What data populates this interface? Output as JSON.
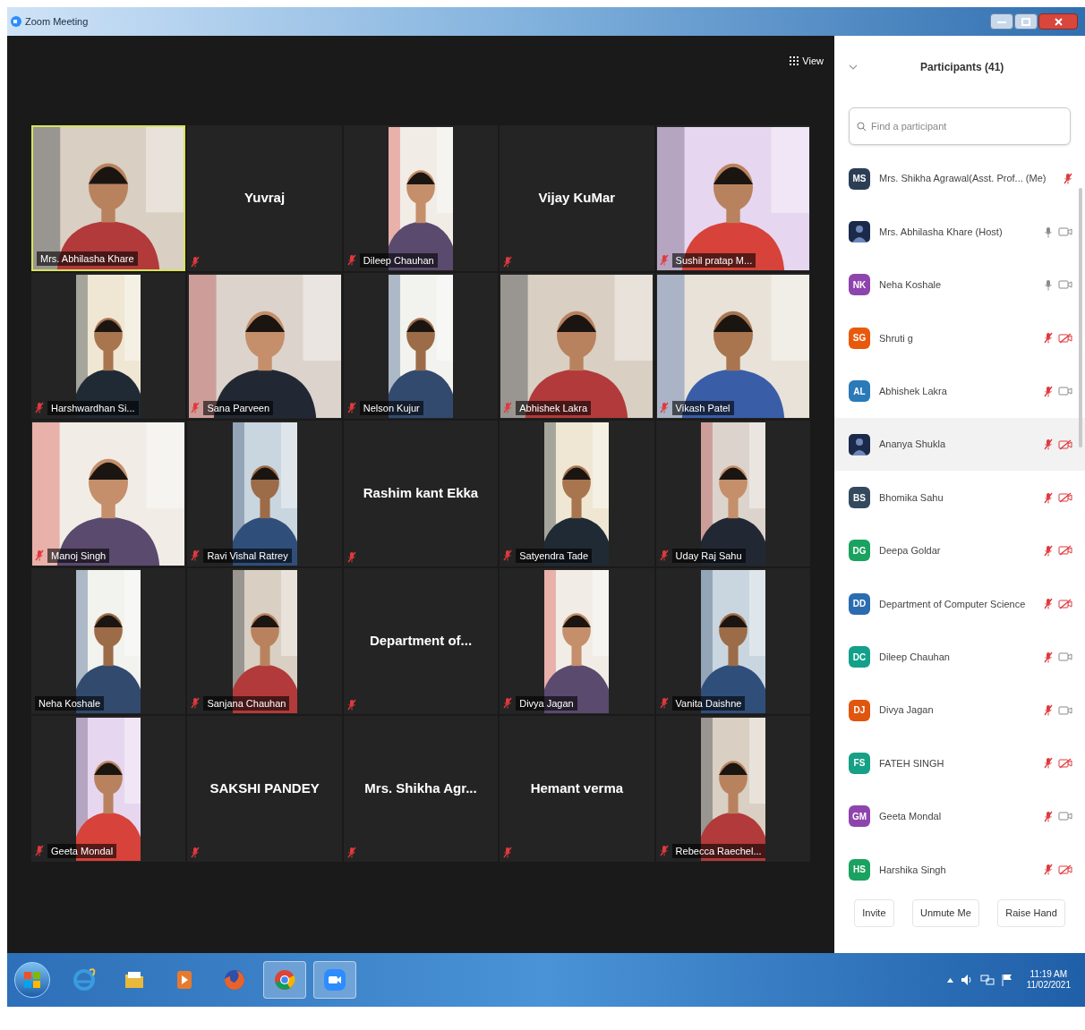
{
  "window": {
    "title": "Zoom Meeting"
  },
  "view_button": {
    "label": "View"
  },
  "tiles": [
    {
      "name": "Mrs. Abhilasha Khare",
      "kind": "video_wide",
      "muted": false,
      "active": true
    },
    {
      "name": "Yuvraj",
      "kind": "no_video",
      "muted": true,
      "active": false
    },
    {
      "name": "Dileep Chauhan",
      "kind": "video_portrait",
      "muted": true,
      "active": false
    },
    {
      "name": "Vijay KuMar",
      "kind": "no_video",
      "muted": true,
      "active": false
    },
    {
      "name": "Sushil pratap M...",
      "kind": "video_wide",
      "muted": true,
      "active": false
    },
    {
      "name": "Harshwardhan Si...",
      "kind": "video_portrait",
      "muted": true,
      "active": false
    },
    {
      "name": "Sana Parveen",
      "kind": "video_wide",
      "muted": true,
      "active": false
    },
    {
      "name": "Nelson Kujur",
      "kind": "video_portrait",
      "muted": true,
      "active": false
    },
    {
      "name": "Abhishek Lakra",
      "kind": "video_wide",
      "muted": true,
      "active": false
    },
    {
      "name": "Vikash Patel",
      "kind": "video_wide",
      "muted": true,
      "active": false
    },
    {
      "name": "Manoj Singh",
      "kind": "video_wide",
      "muted": true,
      "active": false
    },
    {
      "name": "Ravi Vishal Ratrey",
      "kind": "video_portrait",
      "muted": true,
      "active": false
    },
    {
      "name": "Rashim kant Ekka",
      "kind": "no_video",
      "muted": true,
      "active": false
    },
    {
      "name": "Satyendra Tade",
      "kind": "video_portrait",
      "muted": true,
      "active": false
    },
    {
      "name": "Uday Raj Sahu",
      "kind": "video_portrait",
      "muted": true,
      "active": false
    },
    {
      "name": "Neha Koshale",
      "kind": "video_portrait",
      "muted": false,
      "active": false
    },
    {
      "name": "Sanjana Chauhan",
      "kind": "video_portrait",
      "muted": true,
      "active": false
    },
    {
      "name": "Department of...",
      "kind": "no_video",
      "muted": true,
      "active": false
    },
    {
      "name": "Divya Jagan",
      "kind": "video_portrait",
      "muted": true,
      "active": false
    },
    {
      "name": "Vanita Daishne",
      "kind": "video_portrait",
      "muted": true,
      "active": false
    },
    {
      "name": "Geeta Mondal",
      "kind": "video_portrait",
      "muted": true,
      "active": false
    },
    {
      "name": "SAKSHI PANDEY",
      "kind": "no_video",
      "muted": true,
      "active": false
    },
    {
      "name": "Mrs. Shikha Agr...",
      "kind": "no_video",
      "muted": true,
      "active": false
    },
    {
      "name": "Hemant verma",
      "kind": "no_video",
      "muted": true,
      "active": false
    },
    {
      "name": "Rebecca Raechel...",
      "kind": "video_portrait",
      "muted": true,
      "active": false
    }
  ],
  "participants_panel": {
    "title": "Participants (41)",
    "search": {
      "placeholder": "Find a participant"
    },
    "participants": [
      {
        "kind": "initials",
        "initials": "MS",
        "color": "#2c3e55",
        "name": "Mrs. Shikha Agrawal(Asst. Prof... (Me)",
        "muted": true,
        "selected": false
      },
      {
        "name": "Mrs. Abhilasha Khare (Host)",
        "muted": false,
        "video_off": false,
        "selected": false
      },
      {
        "kind": "initials",
        "initials": "NK",
        "color": "#8e44ad",
        "name": "Neha Koshale",
        "muted": false,
        "video_off": false,
        "selected": false
      },
      {
        "kind": "initials",
        "initials": "SG",
        "color": "#e8590c",
        "name": "Shruti g",
        "muted": true,
        "video_off": true,
        "selected": false
      },
      {
        "kind": "initials",
        "initials": "AL",
        "color": "#2a7ab8",
        "name": "Abhishek Lakra",
        "muted": true,
        "video_off": false,
        "selected": false
      },
      {
        "name": "Ananya Shukla",
        "muted": true,
        "video_off": true,
        "selected": true
      },
      {
        "kind": "initials",
        "initials": "BS",
        "color": "#34495e",
        "name": "Bhomika Sahu",
        "muted": true,
        "video_off": true,
        "selected": false
      },
      {
        "kind": "initials",
        "initials": "DG",
        "color": "#1aa260",
        "name": "Deepa Goldar",
        "muted": true,
        "video_off": true,
        "selected": false
      },
      {
        "kind": "initials",
        "initials": "DD",
        "color": "#2b6cb0",
        "name": "Department of Computer Science",
        "muted": true,
        "video_off": true,
        "selected": false
      },
      {
        "kind": "initials",
        "initials": "DC",
        "color": "#13a08a",
        "name": "Dileep Chauhan",
        "muted": true,
        "video_off": false,
        "selected": false
      },
      {
        "kind": "initials",
        "initials": "DJ",
        "color": "#e0560f",
        "name": "Divya Jagan",
        "muted": true,
        "video_off": false,
        "selected": false
      },
      {
        "kind": "initials",
        "initials": "FS",
        "color": "#16a085",
        "name": "FATEH SINGH",
        "muted": true,
        "video_off": true,
        "selected": false
      },
      {
        "kind": "initials",
        "initials": "GM",
        "color": "#8e44ad",
        "name": "Geeta Mondal",
        "muted": true,
        "video_off": false,
        "selected": false
      },
      {
        "kind": "initials",
        "initials": "HS",
        "color": "#1aa260",
        "name": "Harshika Singh",
        "muted": true,
        "video_off": true,
        "selected": false
      }
    ],
    "buttons": [
      "Invite",
      "Unmute Me",
      "Raise Hand"
    ]
  },
  "taskbar": {
    "apps": [
      {
        "kind": "explorer",
        "selected": false
      },
      {
        "kind": "folder",
        "selected": false
      },
      {
        "kind": "media",
        "selected": false
      },
      {
        "kind": "firefox",
        "selected": false
      },
      {
        "kind": "chrome",
        "selected": true
      },
      {
        "kind": "zoom",
        "selected": true
      }
    ],
    "time": "11:19 AM",
    "date": "11/02/2021"
  }
}
